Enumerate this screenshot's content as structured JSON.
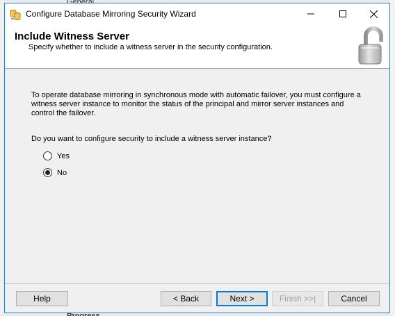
{
  "window": {
    "title": "Configure Database Mirroring Security Wizard"
  },
  "header": {
    "title": "Include Witness Server",
    "subtitle": "Specify whether to include a witness server in the security configuration."
  },
  "content": {
    "explanation": "To operate database mirroring in synchronous mode with automatic failover, you must configure a witness server instance to monitor the status of the principal and mirror server instances and control the failover.",
    "question": "Do you want to configure security to include a witness server instance?",
    "options": [
      {
        "label": "Yes",
        "selected": false
      },
      {
        "label": "No",
        "selected": true
      }
    ]
  },
  "buttons": {
    "help": "Help",
    "back": "< Back",
    "next": "Next >",
    "finish": "Finish >>|",
    "cancel": "Cancel"
  },
  "background": {
    "top_item": "General",
    "bottom_item": "Progress"
  },
  "icons": {
    "title_icon": "database-mirror-icon",
    "header_icon": "padlock-icon"
  },
  "colors": {
    "window_border": "#1883d7",
    "default_button_border": "#0078d7",
    "dialog_background": "#f0f0f0"
  }
}
